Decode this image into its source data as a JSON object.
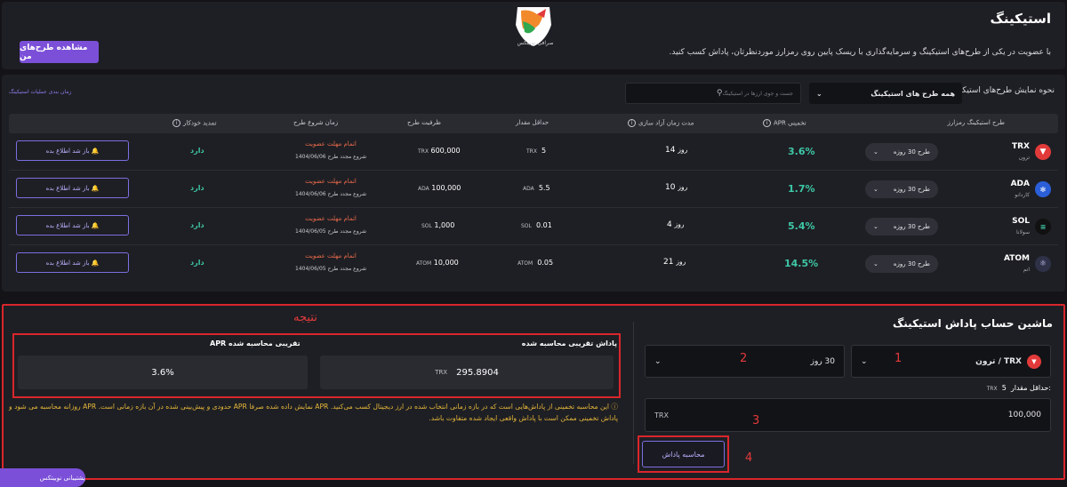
{
  "header": {
    "title": "استیکینگ",
    "subtitle": "با عضویت در یکی از طرح‌های استیکینگ و سرمایه‌گذاری با ریسک پایین روی رمزارز موردنظرتان، پاداش کسب کنید.",
    "my_plans_button": "مشاهده طرح‌های من",
    "logo_text": "صرافی نوبیتکس"
  },
  "filters": {
    "show_label": "نحوه نمایش طرح‌های استیکینگ:",
    "plans_select": "همه طرح های استیکینگ",
    "search_placeholder": "جست و جوی ارزها در استیکینگ",
    "schedule_link": "زمان بندی عملیات استیکینگ"
  },
  "table": {
    "columns": {
      "plan": "طرح استیکینگ رمزارز",
      "apr": "APR تخمینی",
      "release": "مدت زمان آزاد سازی",
      "min": "حداقل مقدار",
      "capacity": "ظرفیت طرح",
      "start": "زمان شروع طرح",
      "auto": "تمدید خودکار"
    },
    "rows": [
      {
        "symbol": "TRX",
        "name": "ترون",
        "plan": "طرح 30 روزه",
        "apr": "3.6%",
        "release_num": "14",
        "release_unit": "روز",
        "min_val": "5",
        "min_unit": "TRX",
        "cap_val": "600,000",
        "cap_unit": "TRX",
        "start_status": "اتمام مهلت عضویت",
        "start_date": "شروع مجدد طرح 1404/06/06",
        "auto": "دارد",
        "notify": "باز شد اطلاع بده"
      },
      {
        "symbol": "ADA",
        "name": "کاردانو",
        "plan": "طرح 30 روزه",
        "apr": "1.7%",
        "release_num": "10",
        "release_unit": "روز",
        "min_val": "5.5",
        "min_unit": "ADA",
        "cap_val": "100,000",
        "cap_unit": "ADA",
        "start_status": "اتمام مهلت عضویت",
        "start_date": "شروع مجدد طرح 1404/06/06",
        "auto": "دارد",
        "notify": "باز شد اطلاع بده"
      },
      {
        "symbol": "SOL",
        "name": "سولانا",
        "plan": "طرح 30 روزه",
        "apr": "5.4%",
        "release_num": "4",
        "release_unit": "روز",
        "min_val": "0.01",
        "min_unit": "SOL",
        "cap_val": "1,000",
        "cap_unit": "SOL",
        "start_status": "اتمام مهلت عضویت",
        "start_date": "شروع مجدد طرح 1404/06/05",
        "auto": "دارد",
        "notify": "باز شد اطلاع بده"
      },
      {
        "symbol": "ATOM",
        "name": "اتم",
        "plan": "طرح 30 روزه",
        "apr": "14.5%",
        "release_num": "21",
        "release_unit": "روز",
        "min_val": "0.05",
        "min_unit": "ATOM",
        "cap_val": "10,000",
        "cap_unit": "ATOM",
        "start_status": "اتمام مهلت عضویت",
        "start_date": "شروع مجدد طرح 1404/06/05",
        "auto": "دارد",
        "notify": "باز شد اطلاع بده"
      }
    ]
  },
  "calculator": {
    "title": "ماشین حساب پاداش استیکینگ",
    "coin_select": "ترون / TRX",
    "period_select": "30 روز",
    "min_label": "حداقل مقدار:",
    "min_val": "5",
    "min_unit": "TRX",
    "amount_value": "100,000",
    "amount_unit": "TRX",
    "calc_button": "محاسبه پاداش",
    "reward_label": "پاداش تقریبی محاسبه شده",
    "reward_value": "295.8904",
    "reward_unit": "TRX",
    "apr_label": "APR تقریبی محاسبه شده",
    "apr_value": "3.6%",
    "note": "این محاسبه تخمینی از پاداش‌هایی است که در بازه زمانی انتخاب شده در ارز دیجیتال کسب می‌کنید. APR نمایش داده شده صرفا APR حدودی و پیش‌بینی شده در آن بازه زمانی است. APR روزانه محاسبه می شود و پاداش تخمینی ممکن است با پاداش واقعی ایجاد شده متفاوت باشد."
  },
  "annotations": {
    "result_label": "نتیجه",
    "n1": "1",
    "n2": "2",
    "n3": "3",
    "n4": "4"
  },
  "chat_button": "پشتیبانی نوبیتکس",
  "colors": {
    "accent": "#7b4fd8",
    "apr_green": "#3ec7a6",
    "status_orange": "#e8694a",
    "annotation_red": "#d9262c"
  }
}
